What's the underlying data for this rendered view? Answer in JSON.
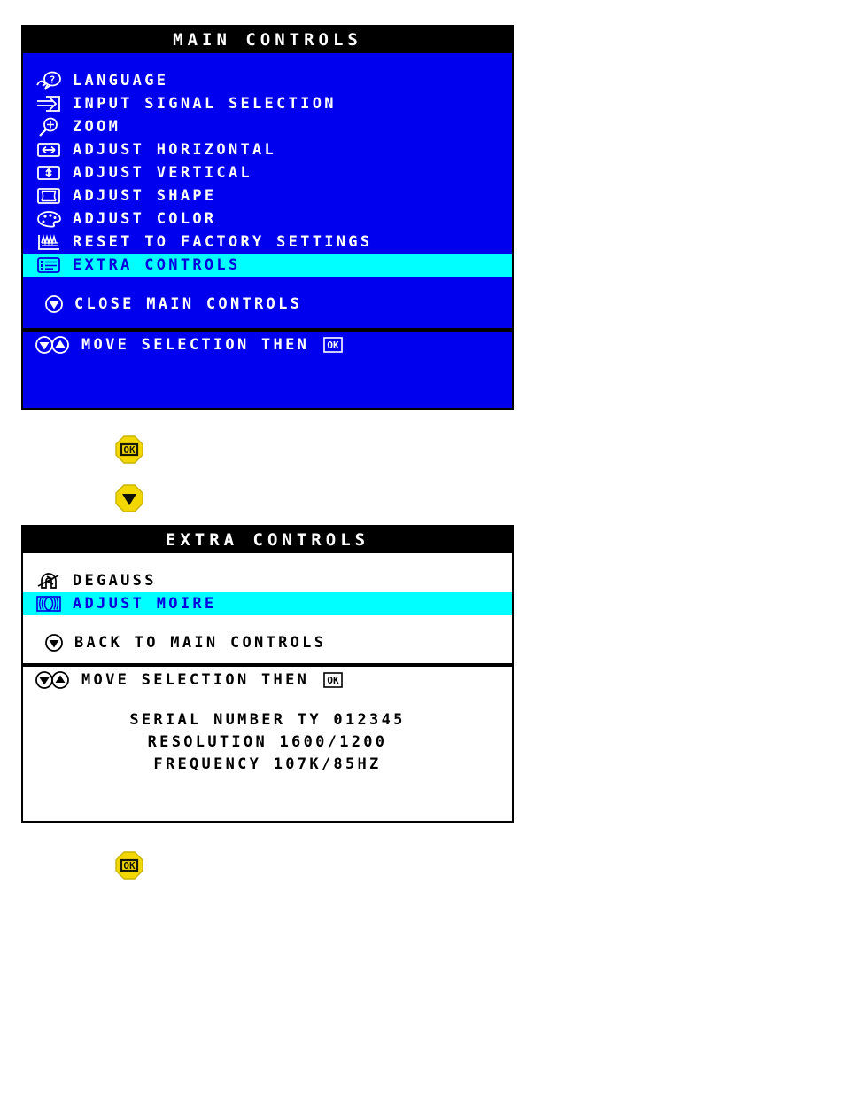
{
  "colors": {
    "panel_bg_blue": "#0000ee",
    "panel_bg_white": "#ffffff",
    "title_bg": "#000000",
    "title_fg": "#ffffff",
    "highlight_bg": "#00ffff",
    "highlight_fg": "#0000dd",
    "text_on_blue": "#ffffff",
    "text_on_white": "#000000",
    "button_yellow": "#f2d800"
  },
  "main_controls": {
    "title": "MAIN CONTROLS",
    "items": [
      {
        "icon": "language-icon",
        "label": "LANGUAGE",
        "selected": false
      },
      {
        "icon": "input-signal-icon",
        "label": "INPUT SIGNAL SELECTION",
        "selected": false
      },
      {
        "icon": "zoom-icon",
        "label": "ZOOM",
        "selected": false
      },
      {
        "icon": "adjust-horizontal-icon",
        "label": "ADJUST HORIZONTAL",
        "selected": false
      },
      {
        "icon": "adjust-vertical-icon",
        "label": "ADJUST VERTICAL",
        "selected": false
      },
      {
        "icon": "adjust-shape-icon",
        "label": "ADJUST SHAPE",
        "selected": false
      },
      {
        "icon": "adjust-color-icon",
        "label": "ADJUST COLOR",
        "selected": false
      },
      {
        "icon": "factory-reset-icon",
        "label": "RESET TO FACTORY SETTINGS",
        "selected": false
      },
      {
        "icon": "extra-controls-icon",
        "label": "EXTRA CONTROLS",
        "selected": true
      }
    ],
    "close": {
      "icon": "down-arrow-icon",
      "label": "CLOSE MAIN CONTROLS"
    },
    "footer": {
      "icon": "updown-arrow-icon",
      "label": "MOVE SELECTION THEN",
      "ok": "OK"
    }
  },
  "extra_controls": {
    "title": "EXTRA CONTROLS",
    "items": [
      {
        "icon": "degauss-icon",
        "label": "DEGAUSS",
        "selected": false
      },
      {
        "icon": "adjust-moire-icon",
        "label": "ADJUST MOIRE",
        "selected": true
      }
    ],
    "back": {
      "icon": "down-arrow-icon",
      "label": "BACK TO MAIN CONTROLS"
    },
    "footer": {
      "icon": "updown-arrow-icon",
      "label": "MOVE SELECTION THEN",
      "ok": "OK"
    },
    "info": [
      "SERIAL NUMBER TY 012345",
      "RESOLUTION 1600/1200",
      "FREQUENCY 107K/85HZ"
    ]
  },
  "buttons": {
    "ok_top": {
      "icon": "ok-button-icon",
      "label": "OK"
    },
    "down_top": {
      "icon": "down-arrow-button-icon",
      "label": "DOWN"
    },
    "ok_bottom": {
      "icon": "ok-button-icon",
      "label": "OK"
    }
  }
}
